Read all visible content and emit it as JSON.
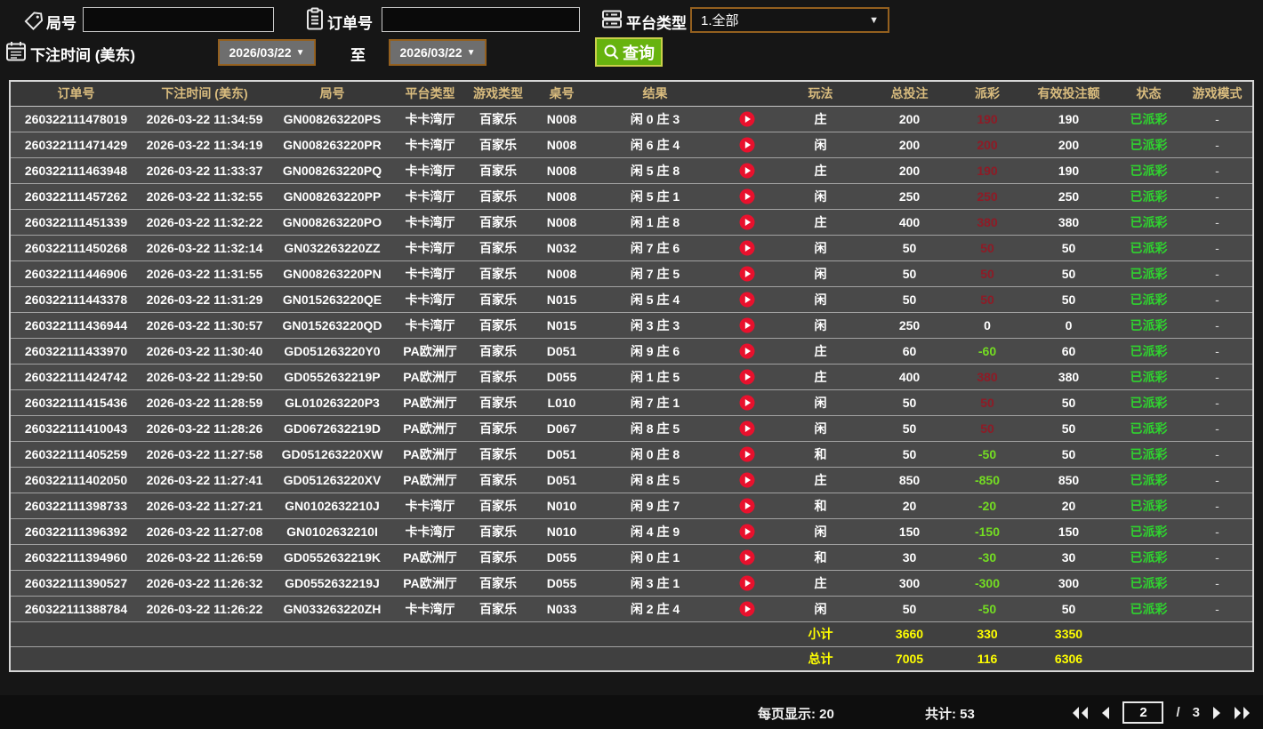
{
  "filters": {
    "game_no_label": "局号",
    "game_no_value": "",
    "order_no_label": "订单号",
    "order_no_value": "",
    "platform_label": "平台类型",
    "platform_value": "1.全部",
    "bet_time_label": "下注时间 (美东)",
    "date_from": "2026/03/22",
    "to_label": "至",
    "date_to": "2026/03/22",
    "search_label": "查询"
  },
  "table": {
    "headers": [
      "订单号",
      "下注时间 (美东)",
      "局号",
      "平台类型",
      "游戏类型",
      "桌号",
      "结果",
      "",
      "玩法",
      "总投注",
      "派彩",
      "有效投注额",
      "状态",
      "游戏模式"
    ],
    "rows": [
      {
        "order_id": "260322111478019",
        "bet_time": "2026-03-22 11:34:59",
        "game_no": "GN008263220PS",
        "platform": "卡卡湾厅",
        "game_type": "百家乐",
        "table_no": "N008",
        "result": "闲 0 庄 3",
        "play": "庄",
        "total_bet": "200",
        "payout": "190",
        "payout_type": "win",
        "valid_bet": "190",
        "status": "已派彩",
        "mode": "-"
      },
      {
        "order_id": "260322111471429",
        "bet_time": "2026-03-22 11:34:19",
        "game_no": "GN008263220PR",
        "platform": "卡卡湾厅",
        "game_type": "百家乐",
        "table_no": "N008",
        "result": "闲 6 庄 4",
        "play": "闲",
        "total_bet": "200",
        "payout": "200",
        "payout_type": "win",
        "valid_bet": "200",
        "status": "已派彩",
        "mode": "-"
      },
      {
        "order_id": "260322111463948",
        "bet_time": "2026-03-22 11:33:37",
        "game_no": "GN008263220PQ",
        "platform": "卡卡湾厅",
        "game_type": "百家乐",
        "table_no": "N008",
        "result": "闲 5 庄 8",
        "play": "庄",
        "total_bet": "200",
        "payout": "190",
        "payout_type": "win",
        "valid_bet": "190",
        "status": "已派彩",
        "mode": "-"
      },
      {
        "order_id": "260322111457262",
        "bet_time": "2026-03-22 11:32:55",
        "game_no": "GN008263220PP",
        "platform": "卡卡湾厅",
        "game_type": "百家乐",
        "table_no": "N008",
        "result": "闲 5 庄 1",
        "play": "闲",
        "total_bet": "250",
        "payout": "250",
        "payout_type": "win",
        "valid_bet": "250",
        "status": "已派彩",
        "mode": "-"
      },
      {
        "order_id": "260322111451339",
        "bet_time": "2026-03-22 11:32:22",
        "game_no": "GN008263220PO",
        "platform": "卡卡湾厅",
        "game_type": "百家乐",
        "table_no": "N008",
        "result": "闲 1 庄 8",
        "play": "庄",
        "total_bet": "400",
        "payout": "380",
        "payout_type": "win",
        "valid_bet": "380",
        "status": "已派彩",
        "mode": "-"
      },
      {
        "order_id": "260322111450268",
        "bet_time": "2026-03-22 11:32:14",
        "game_no": "GN032263220ZZ",
        "platform": "卡卡湾厅",
        "game_type": "百家乐",
        "table_no": "N032",
        "result": "闲 7 庄 6",
        "play": "闲",
        "total_bet": "50",
        "payout": "50",
        "payout_type": "win",
        "valid_bet": "50",
        "status": "已派彩",
        "mode": "-"
      },
      {
        "order_id": "260322111446906",
        "bet_time": "2026-03-22 11:31:55",
        "game_no": "GN008263220PN",
        "platform": "卡卡湾厅",
        "game_type": "百家乐",
        "table_no": "N008",
        "result": "闲 7 庄 5",
        "play": "闲",
        "total_bet": "50",
        "payout": "50",
        "payout_type": "win",
        "valid_bet": "50",
        "status": "已派彩",
        "mode": "-"
      },
      {
        "order_id": "260322111443378",
        "bet_time": "2026-03-22 11:31:29",
        "game_no": "GN015263220QE",
        "platform": "卡卡湾厅",
        "game_type": "百家乐",
        "table_no": "N015",
        "result": "闲 5 庄 4",
        "play": "闲",
        "total_bet": "50",
        "payout": "50",
        "payout_type": "win",
        "valid_bet": "50",
        "status": "已派彩",
        "mode": "-"
      },
      {
        "order_id": "260322111436944",
        "bet_time": "2026-03-22 11:30:57",
        "game_no": "GN015263220QD",
        "platform": "卡卡湾厅",
        "game_type": "百家乐",
        "table_no": "N015",
        "result": "闲 3 庄 3",
        "play": "闲",
        "total_bet": "250",
        "payout": "0",
        "payout_type": "zero",
        "valid_bet": "0",
        "status": "已派彩",
        "mode": "-"
      },
      {
        "order_id": "260322111433970",
        "bet_time": "2026-03-22 11:30:40",
        "game_no": "GD051263220Y0",
        "platform": "PA欧洲厅",
        "game_type": "百家乐",
        "table_no": "D051",
        "result": "闲 9 庄 6",
        "play": "庄",
        "total_bet": "60",
        "payout": "-60",
        "payout_type": "lose",
        "valid_bet": "60",
        "status": "已派彩",
        "mode": "-"
      },
      {
        "order_id": "260322111424742",
        "bet_time": "2026-03-22 11:29:50",
        "game_no": "GD0552632219P",
        "platform": "PA欧洲厅",
        "game_type": "百家乐",
        "table_no": "D055",
        "result": "闲 1 庄 5",
        "play": "庄",
        "total_bet": "400",
        "payout": "380",
        "payout_type": "win",
        "valid_bet": "380",
        "status": "已派彩",
        "mode": "-"
      },
      {
        "order_id": "260322111415436",
        "bet_time": "2026-03-22 11:28:59",
        "game_no": "GL010263220P3",
        "platform": "PA欧洲厅",
        "game_type": "百家乐",
        "table_no": "L010",
        "result": "闲 7 庄 1",
        "play": "闲",
        "total_bet": "50",
        "payout": "50",
        "payout_type": "win",
        "valid_bet": "50",
        "status": "已派彩",
        "mode": "-"
      },
      {
        "order_id": "260322111410043",
        "bet_time": "2026-03-22 11:28:26",
        "game_no": "GD0672632219D",
        "platform": "PA欧洲厅",
        "game_type": "百家乐",
        "table_no": "D067",
        "result": "闲 8 庄 5",
        "play": "闲",
        "total_bet": "50",
        "payout": "50",
        "payout_type": "win",
        "valid_bet": "50",
        "status": "已派彩",
        "mode": "-"
      },
      {
        "order_id": "260322111405259",
        "bet_time": "2026-03-22 11:27:58",
        "game_no": "GD051263220XW",
        "platform": "PA欧洲厅",
        "game_type": "百家乐",
        "table_no": "D051",
        "result": "闲 0 庄 8",
        "play": "和",
        "total_bet": "50",
        "payout": "-50",
        "payout_type": "lose",
        "valid_bet": "50",
        "status": "已派彩",
        "mode": "-"
      },
      {
        "order_id": "260322111402050",
        "bet_time": "2026-03-22 11:27:41",
        "game_no": "GD051263220XV",
        "platform": "PA欧洲厅",
        "game_type": "百家乐",
        "table_no": "D051",
        "result": "闲 8 庄 5",
        "play": "庄",
        "total_bet": "850",
        "payout": "-850",
        "payout_type": "lose",
        "valid_bet": "850",
        "status": "已派彩",
        "mode": "-"
      },
      {
        "order_id": "260322111398733",
        "bet_time": "2026-03-22 11:27:21",
        "game_no": "GN0102632210J",
        "platform": "卡卡湾厅",
        "game_type": "百家乐",
        "table_no": "N010",
        "result": "闲 9 庄 7",
        "play": "和",
        "total_bet": "20",
        "payout": "-20",
        "payout_type": "lose",
        "valid_bet": "20",
        "status": "已派彩",
        "mode": "-"
      },
      {
        "order_id": "260322111396392",
        "bet_time": "2026-03-22 11:27:08",
        "game_no": "GN0102632210I",
        "platform": "卡卡湾厅",
        "game_type": "百家乐",
        "table_no": "N010",
        "result": "闲 4 庄 9",
        "play": "闲",
        "total_bet": "150",
        "payout": "-150",
        "payout_type": "lose",
        "valid_bet": "150",
        "status": "已派彩",
        "mode": "-"
      },
      {
        "order_id": "260322111394960",
        "bet_time": "2026-03-22 11:26:59",
        "game_no": "GD0552632219K",
        "platform": "PA欧洲厅",
        "game_type": "百家乐",
        "table_no": "D055",
        "result": "闲 0 庄 1",
        "play": "和",
        "total_bet": "30",
        "payout": "-30",
        "payout_type": "lose",
        "valid_bet": "30",
        "status": "已派彩",
        "mode": "-"
      },
      {
        "order_id": "260322111390527",
        "bet_time": "2026-03-22 11:26:32",
        "game_no": "GD0552632219J",
        "platform": "PA欧洲厅",
        "game_type": "百家乐",
        "table_no": "D055",
        "result": "闲 3 庄 1",
        "play": "庄",
        "total_bet": "300",
        "payout": "-300",
        "payout_type": "lose",
        "valid_bet": "300",
        "status": "已派彩",
        "mode": "-"
      },
      {
        "order_id": "260322111388784",
        "bet_time": "2026-03-22 11:26:22",
        "game_no": "GN033263220ZH",
        "platform": "卡卡湾厅",
        "game_type": "百家乐",
        "table_no": "N033",
        "result": "闲 2 庄 4",
        "play": "闲",
        "total_bet": "50",
        "payout": "-50",
        "payout_type": "lose",
        "valid_bet": "50",
        "status": "已派彩",
        "mode": "-"
      }
    ],
    "subtotal": {
      "label": "小计",
      "total_bet": "3660",
      "payout": "330",
      "valid_bet": "3350"
    },
    "grand_total": {
      "label": "总计",
      "total_bet": "7005",
      "payout": "116",
      "valid_bet": "6306"
    }
  },
  "footer": {
    "per_page_label": "每页显示:",
    "per_page": "20",
    "total_label": "共计:",
    "total_count": "53",
    "current_page": "2",
    "page_sep": "/",
    "total_pages": "3"
  },
  "colors": {
    "header_gold": "#d9bc7e",
    "status_green": "#2fd32f",
    "payout_win_red": "#8e1b26",
    "payout_lose_green": "#74dd22",
    "sum_yellow": "#ffff00",
    "search_button_green": "#67b30f",
    "picker_border_orange": "#94601f",
    "play_icon_red": "#e8112d"
  }
}
